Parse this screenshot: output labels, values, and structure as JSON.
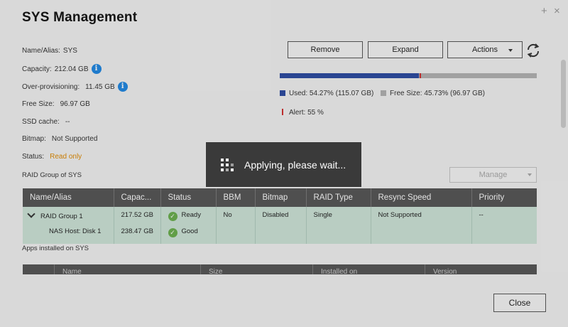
{
  "window": {
    "title": "SYS  Management",
    "plus_glyph": "+",
    "close_glyph": "×"
  },
  "info": {
    "name_label": "Name/Alias:",
    "name_value": "SYS",
    "capacity_label": "Capacity:",
    "capacity_value": "212.04 GB",
    "overprov_label": "Over-provisioning:",
    "overprov_value": "11.45 GB",
    "free_label": "Free Size:",
    "free_value": "96.97 GB",
    "ssd_label": "SSD cache:",
    "ssd_value": "--",
    "bitmap_label": "Bitmap:",
    "bitmap_value": "Not Supported",
    "status_label": "Status:",
    "status_value": "Read only",
    "info_glyph": "i"
  },
  "toolbar": {
    "remove": "Remove",
    "expand": "Expand",
    "actions": "Actions"
  },
  "usage": {
    "used_fraction": 0.5427,
    "alert_fraction": 0.55,
    "used_text": "Used: 54.27% (115.07 GB)",
    "free_text": "Free Size: 45.73% (96.97 GB)",
    "alert_text": "Alert: 55 %"
  },
  "colors": {
    "used": "#2b4aa3",
    "free": "#b4b4b4",
    "alert": "#d32f2f",
    "status_readonly": "#e08a00",
    "ok": "#6ab04c"
  },
  "raid": {
    "section_label": "RAID Group of SYS",
    "manage": "Manage",
    "headers": [
      "Name/Alias",
      "Capac...",
      "Status",
      "BBM",
      "Bitmap",
      "RAID Type",
      "Resync Speed",
      "Priority"
    ],
    "row": {
      "name": "RAID Group 1",
      "sub_name": "NAS Host: Disk 1",
      "capacity": "217.52 GB",
      "sub_capacity": "238.47 GB",
      "status": "Ready",
      "sub_status": "Good",
      "bbm": "No",
      "bitmap": "Disabled",
      "raid_type": "Single",
      "resync": "Not Supported",
      "priority": "--"
    },
    "check_glyph": "✓"
  },
  "apps": {
    "section_label": "Apps installed on SYS",
    "headers": [
      "Name",
      "Size",
      "Installed on",
      "Version"
    ]
  },
  "footer": {
    "close": "Close"
  },
  "toast": {
    "text": "Applying, please wait..."
  },
  "icons": {
    "info": "info-icon",
    "refresh": "refresh-icon",
    "spinner": "spinner-icon",
    "expand": "chevron-down-icon",
    "ok": "checkmark-icon"
  }
}
